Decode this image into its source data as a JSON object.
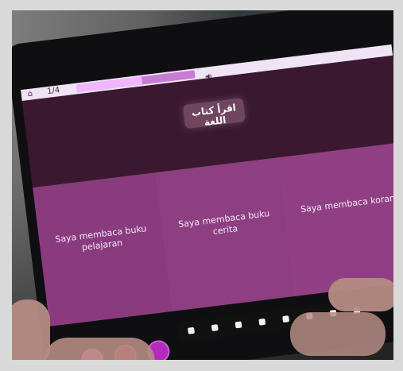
{
  "title": "اقرأ كتاب اللغة",
  "top_left_labels": [
    "⌂",
    "1/4"
  ],
  "progress": 0.55,
  "options": [
    {
      "label": "Saya membaca buku pelajaran"
    },
    {
      "label": "Saya membaca buku cerita"
    },
    {
      "label": "Saya membaca koran"
    }
  ],
  "icons": {
    "home": "home-icon",
    "page": "page-indicator-icon",
    "speaker": "speaker-icon",
    "dock": [
      "app-dot-icon",
      "app-dot-icon",
      "app-dot-icon",
      "app-dot-icon",
      "app-dot-icon",
      "app-dot-icon",
      "app-dot-icon",
      "app-dot-icon"
    ]
  },
  "colors": {
    "screen_dark": "#3a1830",
    "card": "#8a3b7e",
    "progress_track": "#c77bd2",
    "progress_fill": "#f1b6ff"
  }
}
